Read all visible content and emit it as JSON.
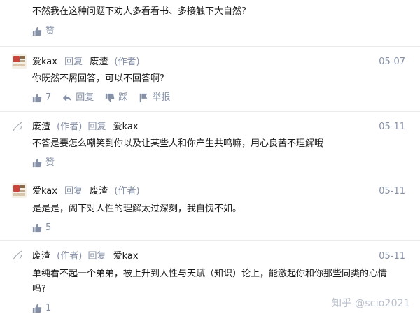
{
  "comments": [
    {
      "text": "不然我在这种问题下劝人多看看书、多接触下大自然?",
      "actions": {
        "like": "赞"
      }
    },
    {
      "author": "爱kax",
      "reply_word": "回复",
      "target": "废渣",
      "target_tag": "(作者)",
      "date": "05-07",
      "text": "你既然不屑回答，可以不回答啊?",
      "actions": {
        "like": "7",
        "reply": "回复",
        "dislike": "踩",
        "report": "举报"
      }
    },
    {
      "author": "废渣",
      "author_tag": "(作者)",
      "reply_word": "回复",
      "target": "爱kax",
      "date": "05-11",
      "text": "不答是要怎么嘲笑到你以及让某些人和你产生共鸣嘛，用心良苦不理解哦",
      "actions": {
        "like": "赞"
      }
    },
    {
      "author": "爱kax",
      "reply_word": "回复",
      "target": "废渣",
      "target_tag": "(作者)",
      "date": "05-11",
      "text": "是是是，阁下对人性的理解太过深刻，我自愧不如。",
      "actions": {
        "like": "5"
      }
    },
    {
      "author": "废渣",
      "author_tag": "(作者)",
      "reply_word": "回复",
      "target": "爱kax",
      "date": "05-11",
      "text_line1": "单纯看不起一个弟弟，被上升到人性与天赋（知识）论上，能激起你和你那些同类的心情",
      "text_line2": "吗?",
      "actions": {
        "like": "1"
      }
    }
  ],
  "watermark": "知乎 @scio2021",
  "colors": {
    "text": "#1a1a1a",
    "grey": "#8590a6",
    "divider": "#ebebeb"
  },
  "icons": {
    "like": "thumbs-up-icon",
    "reply": "reply-arrow-icon",
    "dislike": "thumbs-down-icon",
    "report": "flag-icon"
  }
}
